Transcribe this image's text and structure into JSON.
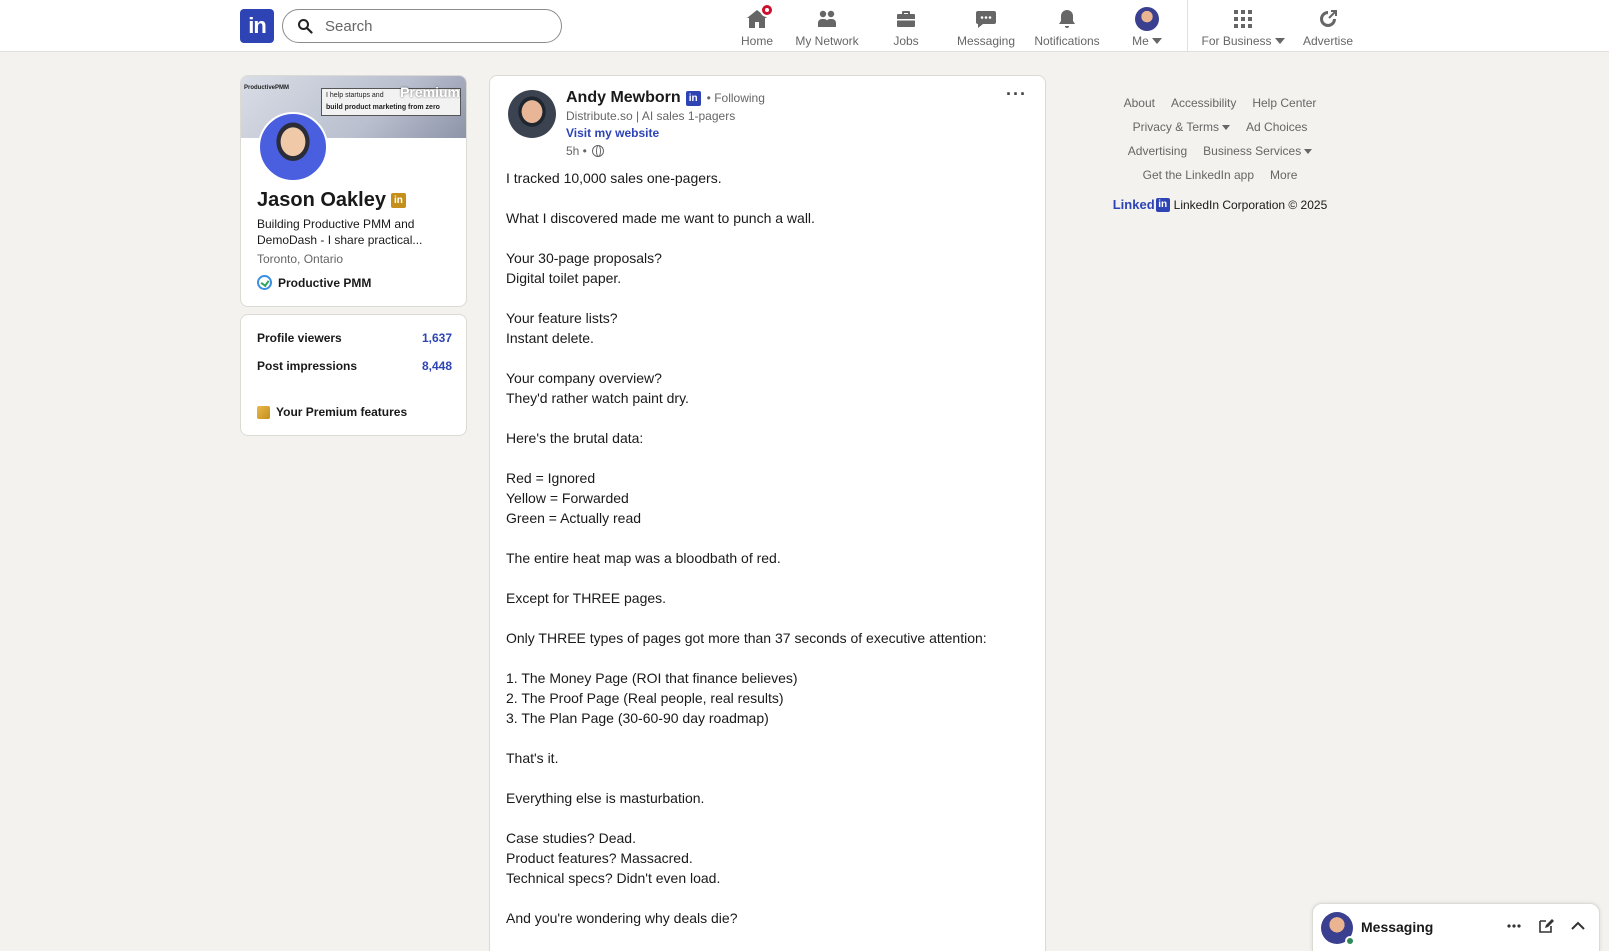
{
  "header": {
    "logo": "in",
    "search_placeholder": "Search",
    "nav": [
      {
        "label": "Home",
        "icon": "home-icon"
      },
      {
        "label": "My Network",
        "icon": "network-icon"
      },
      {
        "label": "Jobs",
        "icon": "briefcase-icon"
      },
      {
        "label": "Messaging",
        "icon": "chat-icon"
      },
      {
        "label": "Notifications",
        "icon": "bell-icon"
      },
      {
        "label": "Me",
        "icon": "avatar"
      },
      {
        "label": "For Business",
        "icon": "grid-icon"
      },
      {
        "label": "Advertise",
        "icon": "advertise-icon"
      }
    ]
  },
  "profile": {
    "banner_premium": "Premium",
    "banner_brand": "ProductivePMM",
    "banner_text_1": "I help startups and",
    "banner_text_2": "build product marketing from zero",
    "name": "Jason Oakley",
    "headline": "Building Productive PMM and DemoDash - I share practical...",
    "location": "Toronto, Ontario",
    "company": "Productive PMM"
  },
  "stats": {
    "viewers_label": "Profile viewers",
    "viewers_value": "1,637",
    "impressions_label": "Post impressions",
    "impressions_value": "8,448",
    "premium_features": "Your Premium features"
  },
  "post": {
    "author": "Andy Mewborn",
    "following": "• Following",
    "subtitle": "Distribute.so | AI sales 1-pagers",
    "visit": "Visit my website",
    "time": "5h •",
    "more": "···",
    "lines": [
      "I tracked 10,000 sales one-pagers.",
      "",
      "What I discovered made me want to punch a wall.",
      "",
      "Your 30-page proposals?",
      "Digital toilet paper.",
      "",
      "Your feature lists?",
      "Instant delete.",
      "",
      "Your company overview?",
      "They'd rather watch paint dry.",
      "",
      "Here's the brutal data:",
      "",
      "Red = Ignored",
      "Yellow = Forwarded",
      "Green = Actually read",
      "",
      "The entire heat map was a bloodbath of red.",
      "",
      "Except for THREE pages.",
      "",
      "Only THREE types of pages got more than 37 seconds of executive attention:",
      "",
      "1. The Money Page (ROI that finance believes)",
      "2. The Proof Page (Real people, real results)",
      "3. The Plan Page (30-60-90 day roadmap)",
      "",
      "That's it.",
      "",
      "Everything else is masturbation.",
      "",
      "Case studies? Dead.",
      "Product features? Massacred.",
      "Technical specs? Didn't even load.",
      "",
      "And you're wondering why deals die?"
    ]
  },
  "footer": {
    "about": "About",
    "accessibility": "Accessibility",
    "help": "Help Center",
    "privacy": "Privacy & Terms",
    "ad_choices": "Ad Choices",
    "advertising": "Advertising",
    "business_services": "Business Services",
    "get_app": "Get the LinkedIn app",
    "more": "More",
    "brand": "Linked",
    "copyright": "LinkedIn Corporation © 2025"
  },
  "messaging": {
    "title": "Messaging"
  },
  "colors": {
    "brand": "#2e44b5",
    "background": "#f4f2ee",
    "notification": "#cb112d",
    "premium_gold": "#c58f1a"
  }
}
